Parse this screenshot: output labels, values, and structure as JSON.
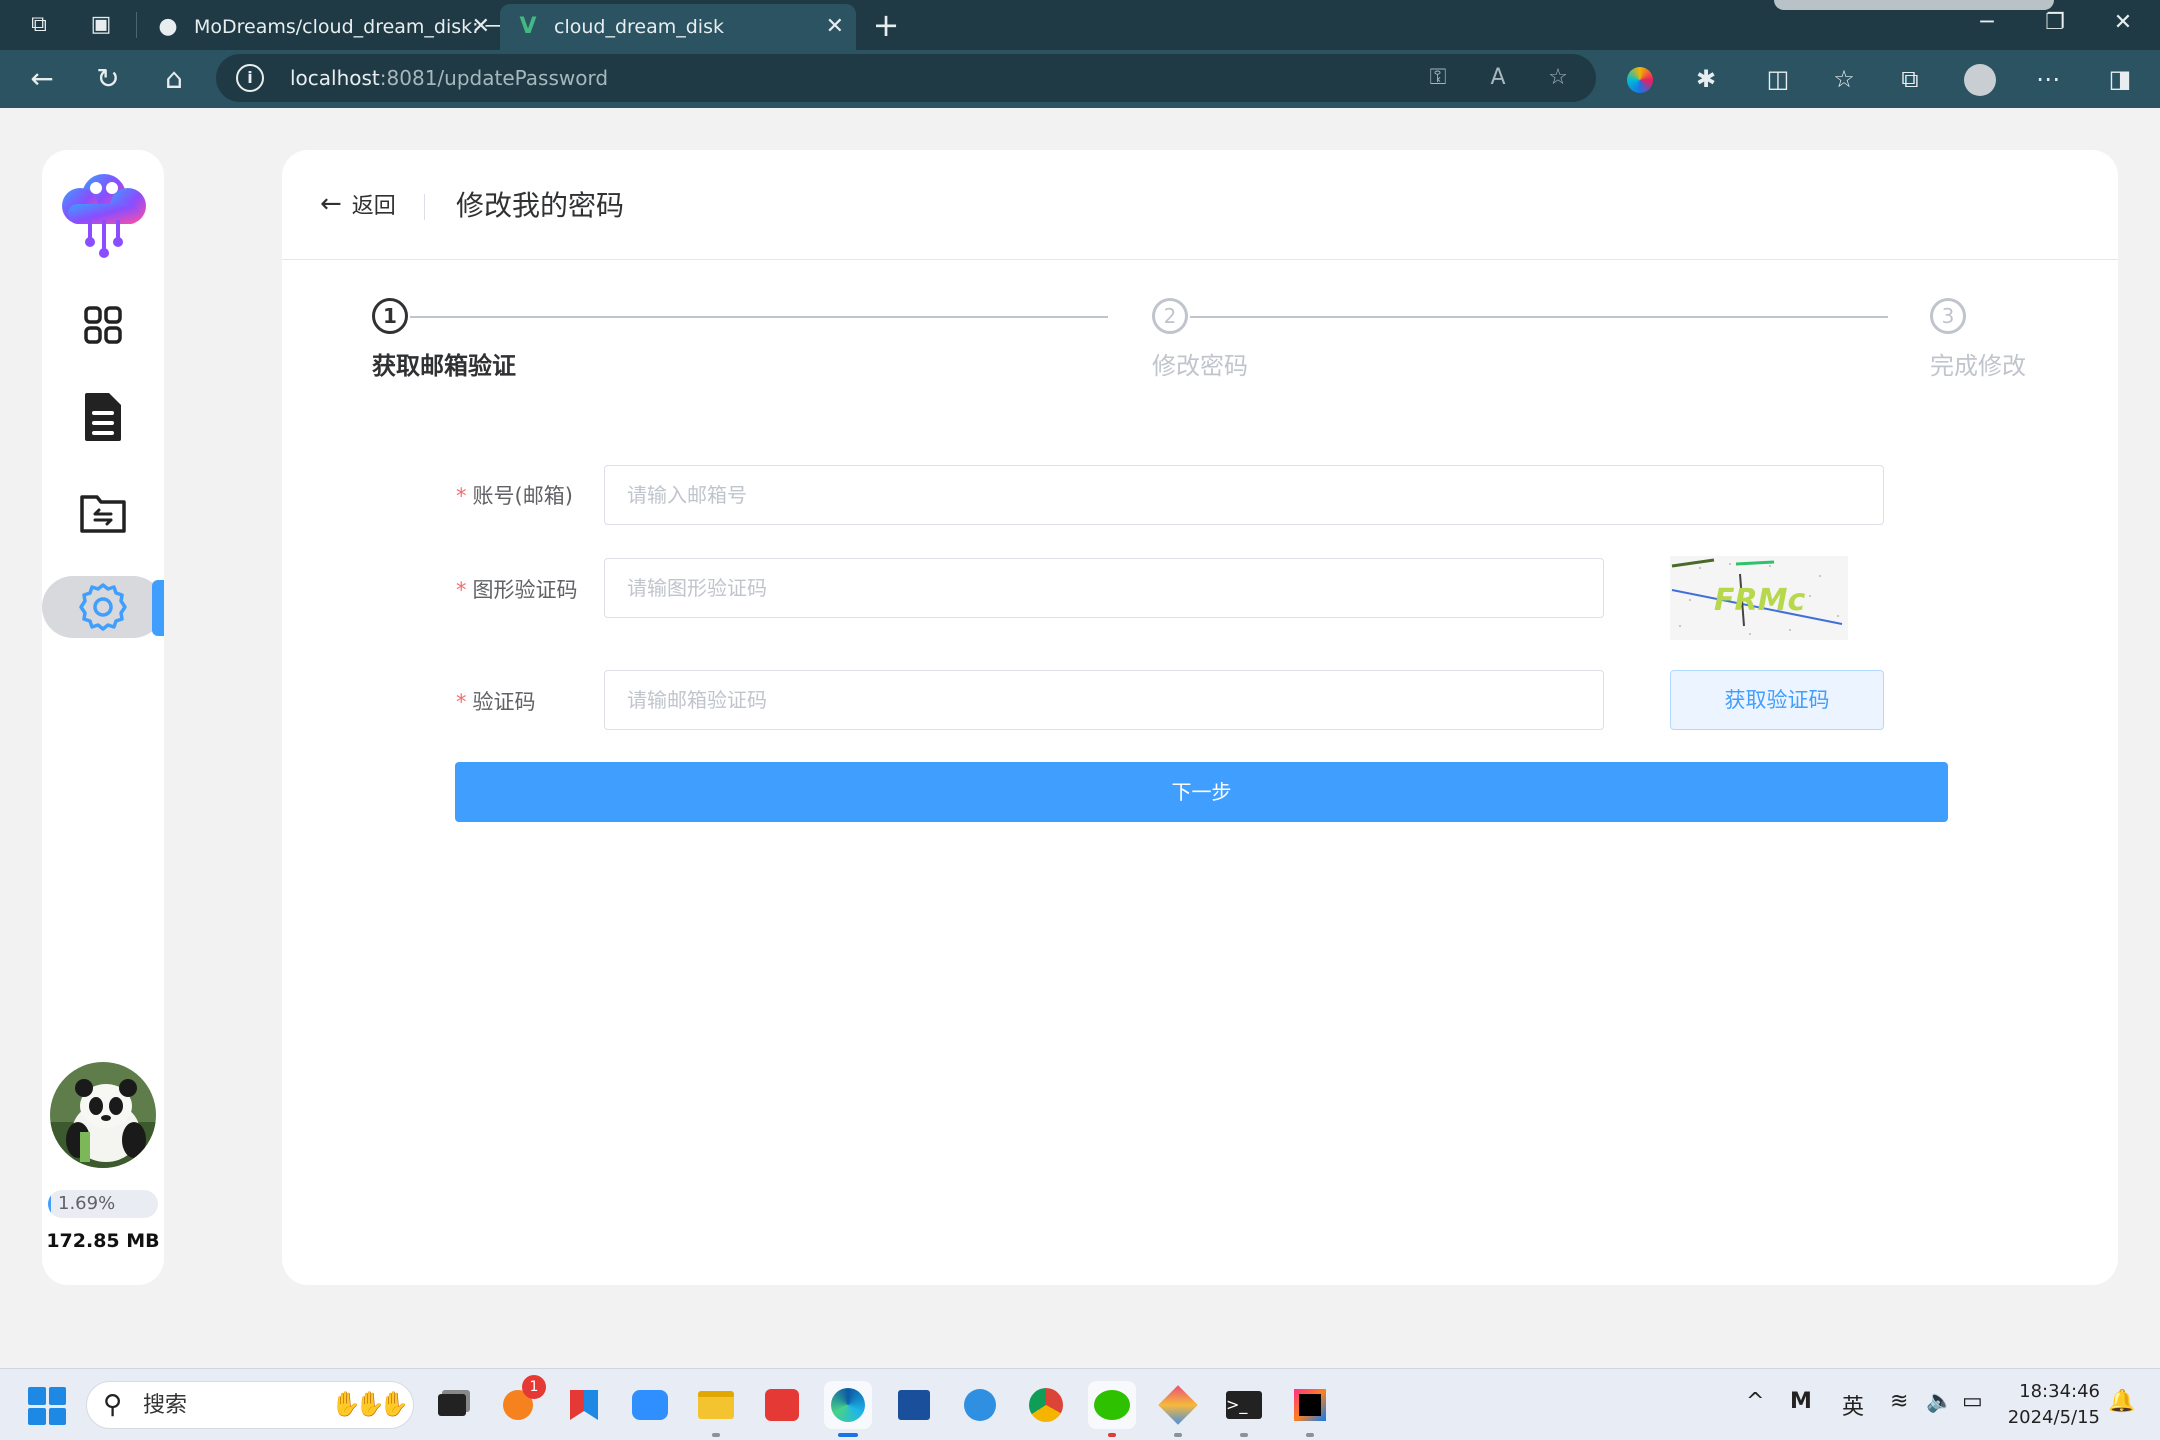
{
  "browser": {
    "tabs": [
      {
        "title": "MoDreams/cloud_dream_disk: 一",
        "icon": "github-icon"
      },
      {
        "title": "cloud_dream_disk",
        "icon": "vue-icon"
      }
    ],
    "url_host": "localhost",
    "url_path": ":8081/updatePassword"
  },
  "sidebar": {
    "items": [
      {
        "name": "dashboard",
        "icon": "grid-icon"
      },
      {
        "name": "files",
        "icon": "document-icon"
      },
      {
        "name": "share",
        "icon": "folder-share-icon"
      },
      {
        "name": "settings",
        "icon": "gear-icon",
        "active": true
      }
    ],
    "usage_percent": 1.69,
    "usage_text": "1.69%",
    "storage_used": "172.85 MB"
  },
  "header": {
    "back_label": "返回",
    "title": "修改我的密码"
  },
  "steps": [
    {
      "number": "1",
      "label": "获取邮箱验证",
      "status": "current"
    },
    {
      "number": "2",
      "label": "修改密码",
      "status": "wait"
    },
    {
      "number": "3",
      "label": "完成修改",
      "status": "wait"
    }
  ],
  "form": {
    "account_label": "账号(邮箱)",
    "account_placeholder": "请输入邮箱号",
    "account_value": "",
    "captcha_label": "图形验证码",
    "captcha_placeholder": "请输图形验证码",
    "captcha_value": "",
    "captcha_image_text": "FRMc",
    "code_label": "验证码",
    "code_placeholder": "请输邮箱验证码",
    "code_value": "",
    "get_code_label": "获取验证码",
    "next_label": "下一步"
  },
  "taskbar": {
    "search_label": "搜索",
    "notification_count": "1",
    "input_method": "英",
    "time": "18:34:46",
    "date": "2024/5/15"
  },
  "colors": {
    "primary": "#409eff",
    "browser_bar": "#2b5361",
    "title_bar": "#1f3a44",
    "required": "#f56c6c"
  }
}
